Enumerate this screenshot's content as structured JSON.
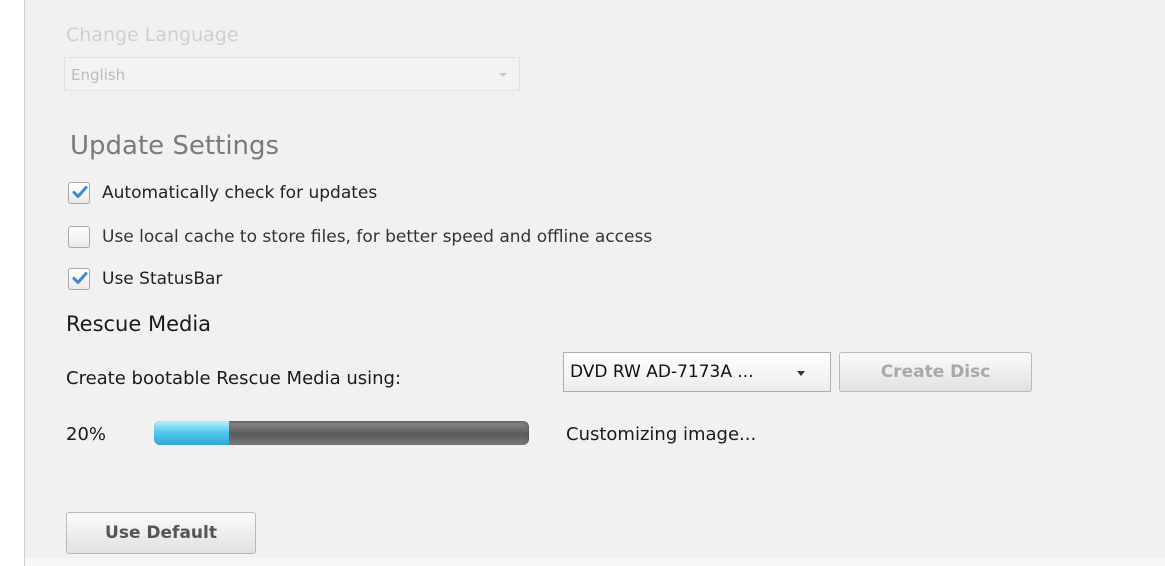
{
  "language": {
    "label": "Change Language",
    "selected": "English"
  },
  "update_settings": {
    "title": "Update Settings",
    "options": [
      {
        "label": "Automatically check for updates",
        "checked": true
      },
      {
        "label": "Use local cache to store files, for better speed and offline access",
        "checked": false
      },
      {
        "label": "Use StatusBar",
        "checked": true
      }
    ]
  },
  "rescue_media": {
    "title": "Rescue Media",
    "create_label": "Create bootable Rescue Media using:",
    "drive_selected": "DVD RW AD-7173A  ...",
    "create_button": "Create Disc",
    "progress_text": "20%",
    "progress_fraction": 0.2,
    "status": "Customizing image..."
  },
  "footer": {
    "default_button": "Use Default"
  },
  "colors": {
    "check": "#3d87d4",
    "progress_fill": "#4fc6ea",
    "progress_track": "#6a6a6a"
  },
  "icons": {
    "checkbox_check": "checkmark-icon",
    "dropdown_caret": "chevron-down-icon"
  }
}
